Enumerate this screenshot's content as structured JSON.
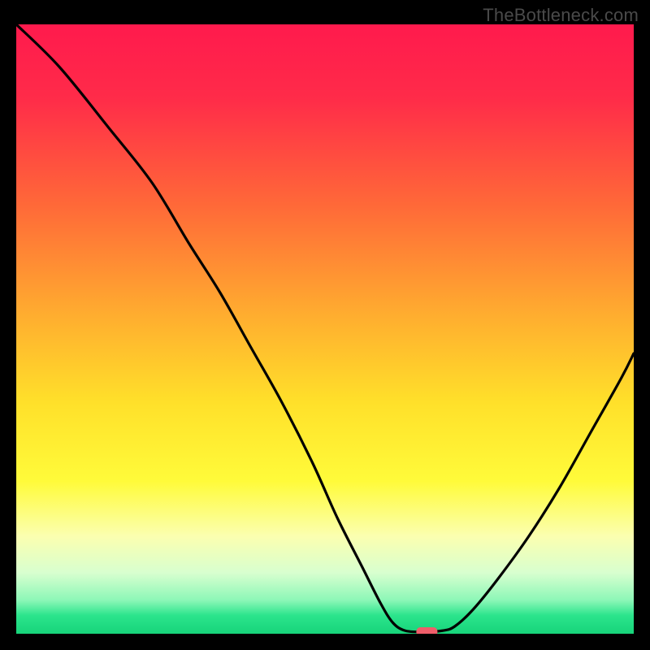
{
  "watermark": "TheBottleneck.com",
  "chart_data": {
    "type": "line",
    "title": "",
    "xlabel": "",
    "ylabel": "",
    "xlim": [
      0,
      100
    ],
    "ylim": [
      0,
      100
    ],
    "gradient_stops": [
      {
        "offset": 0.0,
        "color": "#ff1a4d"
      },
      {
        "offset": 0.12,
        "color": "#ff2b49"
      },
      {
        "offset": 0.3,
        "color": "#ff6a38"
      },
      {
        "offset": 0.48,
        "color": "#ffae2f"
      },
      {
        "offset": 0.62,
        "color": "#ffe02a"
      },
      {
        "offset": 0.75,
        "color": "#fffb3a"
      },
      {
        "offset": 0.84,
        "color": "#fbffb0"
      },
      {
        "offset": 0.9,
        "color": "#d8ffcf"
      },
      {
        "offset": 0.945,
        "color": "#8cf7b7"
      },
      {
        "offset": 0.97,
        "color": "#2be48c"
      },
      {
        "offset": 1.0,
        "color": "#17d47a"
      }
    ],
    "series": [
      {
        "name": "bottleneck-curve",
        "points": [
          {
            "x": 0,
            "y": 100
          },
          {
            "x": 7,
            "y": 93
          },
          {
            "x": 15,
            "y": 83
          },
          {
            "x": 22,
            "y": 74
          },
          {
            "x": 28,
            "y": 64
          },
          {
            "x": 33,
            "y": 56
          },
          {
            "x": 38,
            "y": 47
          },
          {
            "x": 43,
            "y": 38
          },
          {
            "x": 48,
            "y": 28
          },
          {
            "x": 52,
            "y": 19
          },
          {
            "x": 56,
            "y": 11
          },
          {
            "x": 59,
            "y": 5
          },
          {
            "x": 61,
            "y": 1.8
          },
          {
            "x": 63,
            "y": 0.5
          },
          {
            "x": 66,
            "y": 0.3
          },
          {
            "x": 69,
            "y": 0.5
          },
          {
            "x": 71,
            "y": 1.2
          },
          {
            "x": 74,
            "y": 4
          },
          {
            "x": 78,
            "y": 9
          },
          {
            "x": 83,
            "y": 16
          },
          {
            "x": 88,
            "y": 24
          },
          {
            "x": 93,
            "y": 33
          },
          {
            "x": 98,
            "y": 42
          },
          {
            "x": 100,
            "y": 46
          }
        ]
      }
    ],
    "marker": {
      "x": 66.5,
      "y": 0,
      "color": "#ef5e6a"
    }
  }
}
